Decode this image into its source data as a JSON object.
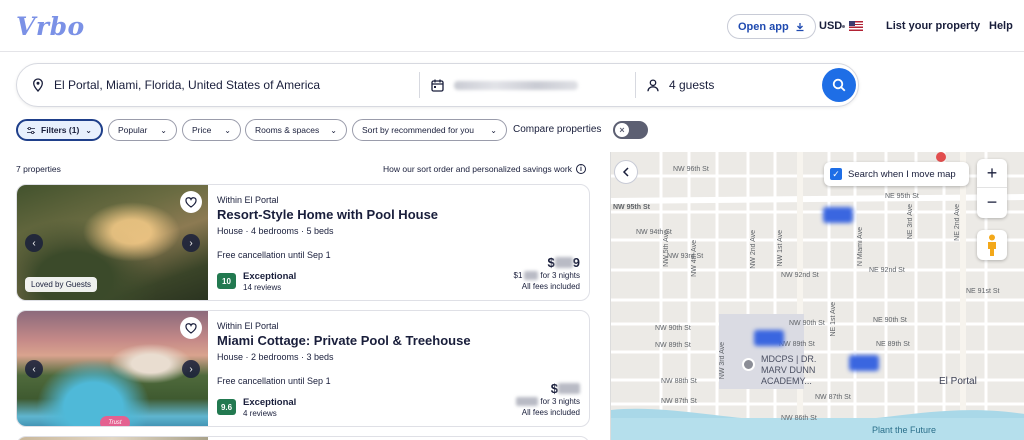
{
  "header": {
    "logo": "Vrbo",
    "open_app": "Open app",
    "currency": "USD",
    "list_property": "List your property",
    "help": "Help"
  },
  "search": {
    "destination": "El Portal, Miami, Florida, United States of America",
    "guests": "4 guests"
  },
  "filters": {
    "filters_chip": "Filters (1)",
    "popular": "Popular",
    "price": "Price",
    "rooms": "Rooms & spaces",
    "sort": "Sort by recommended for you",
    "compare": "Compare properties"
  },
  "results": {
    "count": "7 properties",
    "sort_note": "How our sort order and personalized savings work"
  },
  "listings": [
    {
      "location": "Within El Portal",
      "title": "Resort-Style Home with Pool House",
      "meta": "House · 4 bedrooms · 5 beds",
      "cancellation": "Free cancellation until Sep 1",
      "score": "10",
      "score_label": "Exceptional",
      "reviews": "14 reviews",
      "badge": "Loved by Guests",
      "price_main_prefix": "$",
      "price_main_suffix": "9",
      "price_sub_prefix": "$1",
      "price_sub_suffix": "for 3 nights",
      "fees": "All fees included"
    },
    {
      "location": "Within El Portal",
      "title": "Miami Cottage: Private Pool & Treehouse",
      "meta": "House · 2 bedrooms · 3 beds",
      "cancellation": "Free cancellation until Sep 1",
      "score": "9.6",
      "score_label": "Exceptional",
      "reviews": "4 reviews",
      "badge": "Trust",
      "price_main_prefix": "$",
      "price_main_suffix": "",
      "price_sub_prefix": "",
      "price_sub_suffix": "for 3 nights",
      "fees": "All fees included"
    }
  ],
  "map": {
    "search_when_move": "Search when I move map",
    "school": "MDCPS | DR. MARV DUNN ACADEMY...",
    "place": "El Portal",
    "plant": "Plant the Future",
    "streets": {
      "nw96": "NW 96th St",
      "nw95": "NW 95th St",
      "ne95": "NE 95th St",
      "nw94": "NW 94th St",
      "nw93": "NW 93rd St",
      "nw92": "NW 92nd St",
      "ne92": "NE 92nd St",
      "ne91": "NE 91st St",
      "nw90": "NW 90th St",
      "nw90b": "NW 90th St",
      "ne90": "NE 90th St",
      "nw89": "NW 89th St",
      "nw89b": "NW 89th St",
      "ne89": "NE 89th St",
      "nw88": "NW 88th St",
      "nw87": "NW 87th St",
      "nw87b": "NW 87th St",
      "nw86": "NW 86th St",
      "nw5ave": "NW 5th Ave",
      "nw4ave": "NW 4th Ave",
      "nw3ave": "NW 3rd Ave",
      "nw2ave": "NW 2nd Ave",
      "nw1ave": "NW 1st Ave",
      "nmiami": "N Miami Ave",
      "ne1ave": "NE 1st Ave",
      "ne2ave": "NE 2nd Ave",
      "ne3ave": "NE 3rd Ave"
    }
  },
  "colors": {
    "brand": "#7b91e6",
    "primary_blue": "#1e6ee6",
    "score_green": "#227950"
  }
}
